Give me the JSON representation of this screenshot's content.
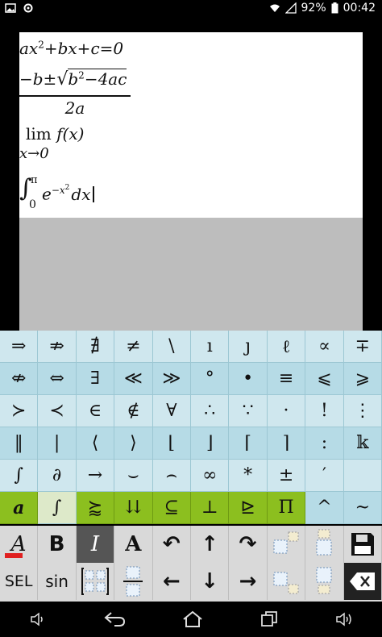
{
  "status_bar": {
    "battery": "92%",
    "time": "00:42"
  },
  "editor": {
    "eq1": {
      "a": "ax",
      "sup": "2",
      "rest": "+bx+c=0"
    },
    "eq2": {
      "num_pre": "−b±",
      "num_rad": "b",
      "num_sup": "2",
      "num_post": "−4ac",
      "den": "2a"
    },
    "eq3": {
      "fn": "lim",
      "arg": "f(x)",
      "sub": "x→0"
    },
    "eq4": {
      "int": "∫",
      "upper": "π",
      "lower": "0",
      "e": "e",
      "exp": "−x",
      "exp_sup": "2",
      "dx": "dx"
    }
  },
  "keyboard": {
    "row1": [
      "⇒",
      "⇏",
      "∄",
      "≠",
      "\\",
      "ı",
      "ȷ",
      "ℓ",
      "∝",
      "∓"
    ],
    "row2": [
      "⇎",
      "⇔",
      "∃",
      "≪",
      "≫",
      "°",
      "•",
      "≡",
      "⩽",
      "⩾"
    ],
    "row3": [
      "≻",
      "≺",
      "∈",
      "∉",
      "∀",
      "∴",
      "∵",
      "·",
      "!",
      "⋮"
    ],
    "row4": [
      "‖",
      "|",
      "⟨",
      "⟩",
      "⌊",
      "⌋",
      "⌈",
      "⌉",
      ":",
      "𝕜"
    ],
    "row5": [
      "∫",
      "∂",
      "→",
      "⌣",
      "⌢",
      "∞",
      "*",
      "±",
      "′",
      ""
    ],
    "row6": [
      "a",
      "∫",
      "⪸",
      "⇊",
      "⊆",
      "⊥",
      "⊵",
      "Π",
      "^",
      "~"
    ]
  },
  "toolbar": {
    "row1": [
      "A",
      "B",
      "I",
      "A",
      "↶",
      "↑",
      "↷",
      "",
      "",
      ""
    ],
    "row2": [
      "SEL",
      "sin",
      "",
      "",
      "←",
      "↓",
      "→",
      "",
      "",
      ""
    ]
  }
}
